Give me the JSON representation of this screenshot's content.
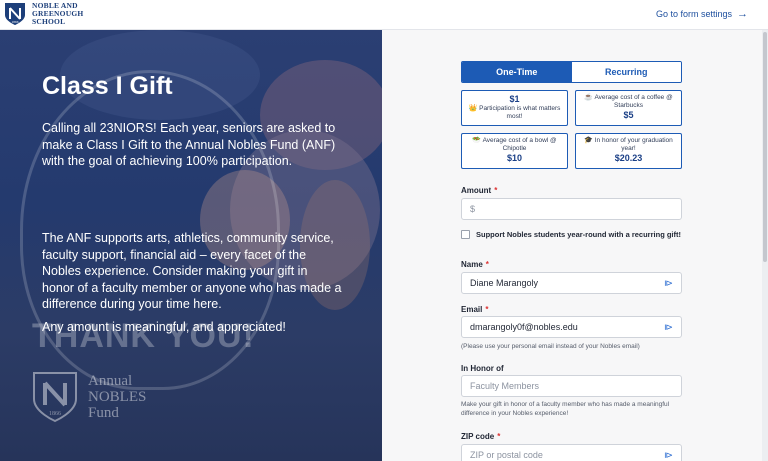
{
  "header": {
    "logo_line1": "NOBLE AND",
    "logo_line2": "GREENOUGH",
    "logo_line3": "SCHOOL",
    "logo_year": "1866",
    "settings_link": "Go to form settings"
  },
  "hero": {
    "title": "Class I Gift",
    "paragraph1": "Calling all 23NIORS! Each year, seniors are asked to make a Class I Gift to the Annual Nobles Fund (ANF) with the goal of achieving 100% participation.",
    "paragraph2": "The ANF supports arts, athletics, community service, faculty support, financial aid – every facet of the Nobles experience. Consider making your gift in honor of a faculty member or anyone who has made a difference during your time here.",
    "paragraph3": "Any amount is meaningful, and appreciated!",
    "bg_text": "THANK YOU!",
    "fund_line1": "Annual",
    "fund_line2": "NOBLES",
    "fund_line3": "Fund",
    "fund_year": "1866"
  },
  "form": {
    "frequency": {
      "one_time": "One-Time",
      "recurring": "Recurring",
      "selected": "One-Time"
    },
    "presets": [
      {
        "amount": "$1",
        "desc": "Participation is what matters most!",
        "icon": "crown-icon"
      },
      {
        "amount": "$5",
        "desc": "Average cost of a coffee @ Starbucks",
        "icon": "coffee-icon"
      },
      {
        "amount": "$10",
        "desc": "Average cost of a bowl @ Chipotle",
        "icon": "bowl-icon"
      },
      {
        "amount": "$20.23",
        "desc": "In honor of your graduation year!",
        "icon": "grad-cap-icon"
      }
    ],
    "amount": {
      "label": "Amount",
      "placeholder": "$"
    },
    "recurring_checkbox": "Support Nobles students year-round with a recurring gift!",
    "name": {
      "label": "Name",
      "value": "Diane Marangoly"
    },
    "email": {
      "label": "Email",
      "value": "dmarangoly0f@nobles.edu",
      "hint": "(Please use your personal email instead of your Nobles email)"
    },
    "honor": {
      "label": "In Honor of",
      "placeholder": "Faculty Members",
      "hint": "Make your gift in honor of a faculty member who has made a meaningful difference in your Nobles experience!"
    },
    "zip": {
      "label": "ZIP code",
      "placeholder": "ZIP or postal code"
    }
  },
  "colors": {
    "accent": "#1d5bb5",
    "hero_bg": "#2b3f73",
    "required": "#dd3333"
  }
}
